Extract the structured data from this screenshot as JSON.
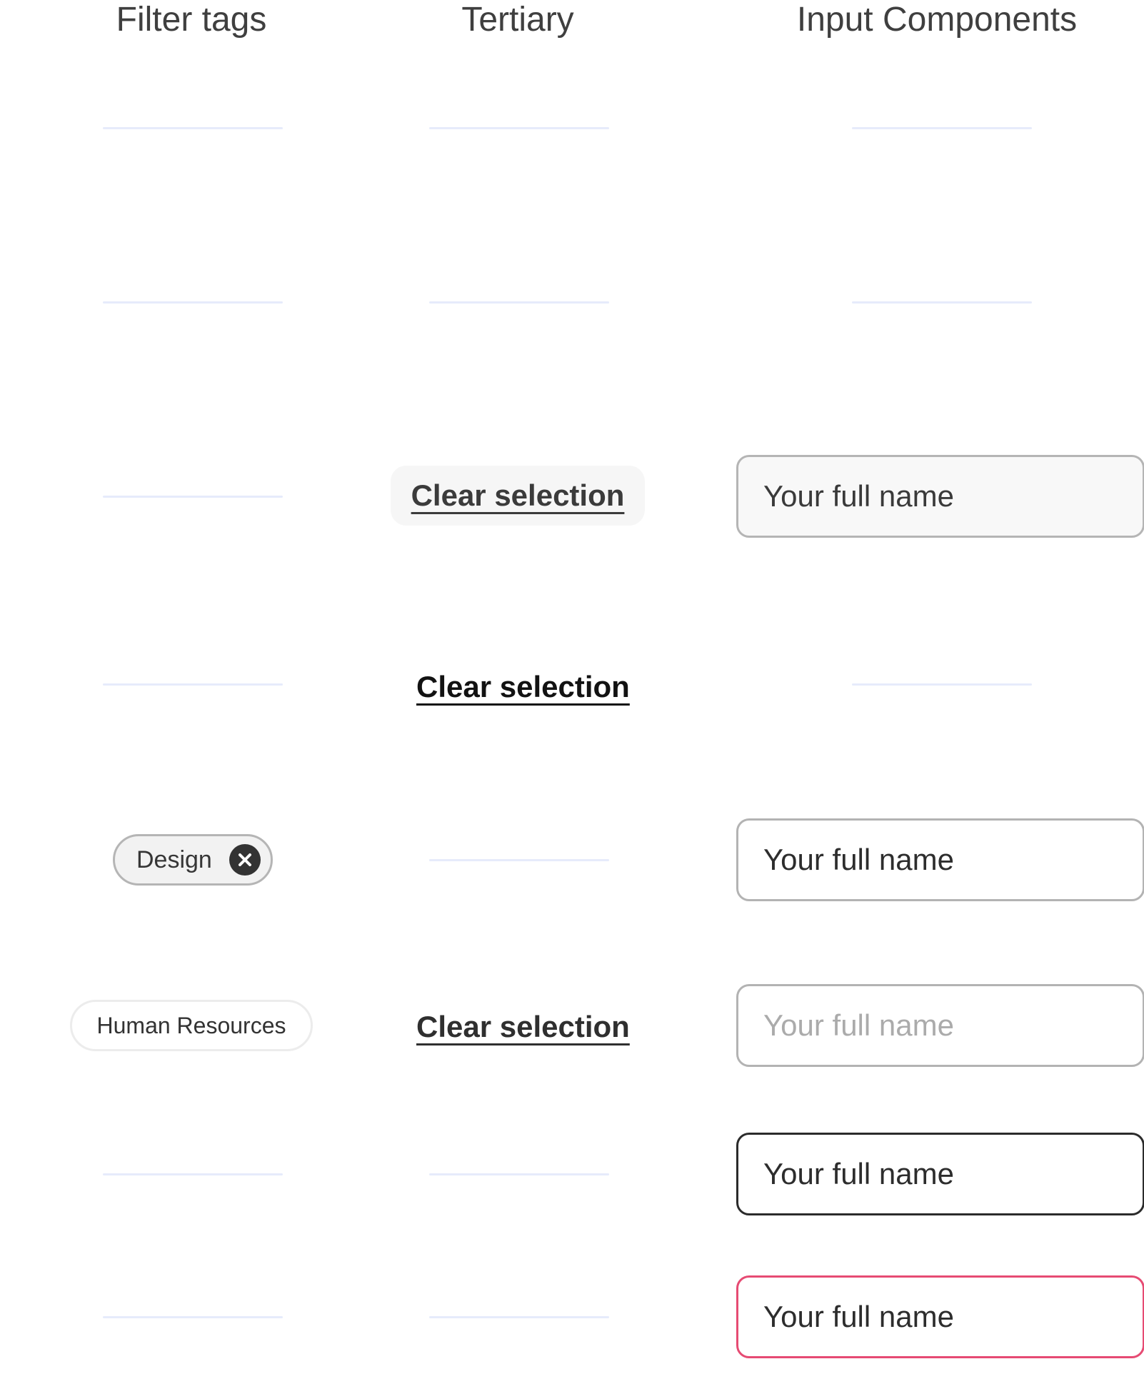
{
  "columns": {
    "filter_tags": "Filter tags",
    "tertiary": "Tertiary",
    "input_components": "Input Components"
  },
  "tertiary": {
    "hover_label": "Clear selection",
    "pressed_label": "Clear selection",
    "default_label": "Clear selection"
  },
  "filter_tags": {
    "selected_label": "Design",
    "default_label": "Human Resources"
  },
  "inputs": {
    "disabled_value": "Your full name",
    "filled_value": "Your full name",
    "placeholder": "Your full name",
    "focused_value": "Your full name",
    "error_value": "Your full name"
  },
  "colors": {
    "placeholder_line": "#e6ebfb",
    "error_border": "#e64b73",
    "focus_border": "#2b2b2b"
  },
  "icons": {
    "tag_remove": "close-circle-icon"
  }
}
